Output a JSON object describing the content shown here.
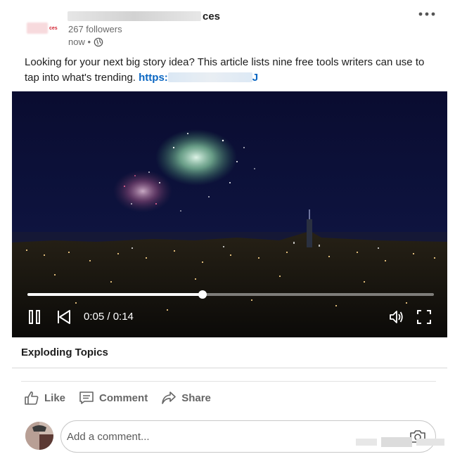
{
  "post": {
    "company_name_suffix": "ces",
    "followers": "267 followers",
    "time": "now •",
    "text_main": "Looking for your next big story idea? This article lists nine free tools writers can use to tap into what's trending. ",
    "link_prefix": "https:",
    "link_suffix": "J"
  },
  "video": {
    "time_display": "0:05 / 0:14",
    "progress": 0.43,
    "controls": [
      "pause-icon",
      "previous-icon",
      "volume-icon",
      "fullscreen-icon"
    ]
  },
  "caption": {
    "title": "Exploding Topics"
  },
  "actions": {
    "like": "Like",
    "comment": "Comment",
    "share": "Share"
  },
  "comment": {
    "placeholder": "Add a comment..."
  },
  "colors": {
    "link": "#0a66c2",
    "action_gray": "#666666",
    "video_sky": "#0b0d2c"
  }
}
